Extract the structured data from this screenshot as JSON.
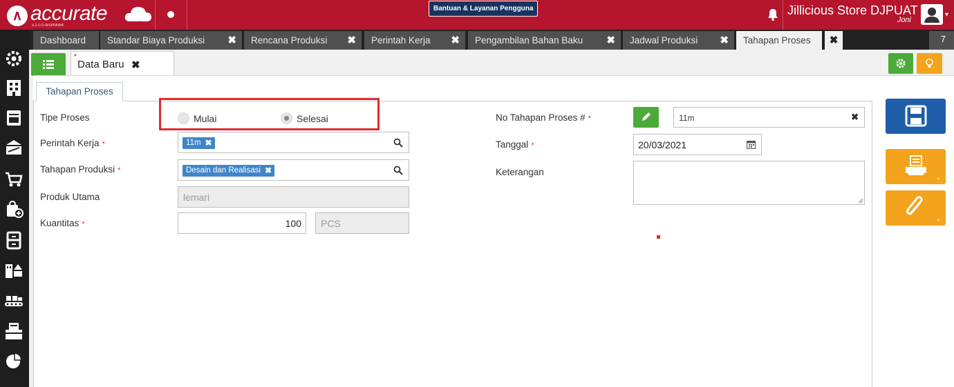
{
  "app": {
    "brand": "accurate",
    "brand_sub": "online",
    "version": "v.1.0.0-test#9564",
    "help_button": "Bantuan & Layanan Pengguna",
    "store_name": "Jillicious Store DJPUAT",
    "user_name": "Joni"
  },
  "tabs": [
    {
      "label": "Dashboard",
      "closable": false
    },
    {
      "label": "Standar Biaya Produksi",
      "closable": true
    },
    {
      "label": "Rencana Produksi",
      "closable": true
    },
    {
      "label": "Perintah Kerja",
      "closable": true
    },
    {
      "label": "Pengambilan Bahan Baku",
      "closable": true
    },
    {
      "label": "Jadwal Produksi",
      "closable": true
    },
    {
      "label": "Tahapan Proses",
      "closable": true,
      "active": true
    }
  ],
  "tab_close_symbol": "✖",
  "tab_count": "7",
  "subtab": {
    "asterisk": "*",
    "label": "Data Baru",
    "close": "✖"
  },
  "section_tab": "Tahapan Proses",
  "form": {
    "tipe_proses": {
      "label": "Tipe Proses",
      "options": [
        "Mulai",
        "Selesai"
      ],
      "selected": "Selesai"
    },
    "perintah_kerja": {
      "label": "Perintah Kerja",
      "required": "*",
      "chip": "11m",
      "chip_close": "✖"
    },
    "tahapan_produksi": {
      "label": "Tahapan Produksi",
      "required": "*",
      "chip": "Desain dan Realisasi",
      "chip_close": "✖"
    },
    "produk_utama": {
      "label": "Produk Utama",
      "value": "lemari"
    },
    "kuantitas": {
      "label": "Kuantitas",
      "required": "*",
      "value": "100",
      "unit": "PCS"
    },
    "no_tahapan": {
      "label": "No Tahapan Proses #",
      "required": "*",
      "value": "11m",
      "clear": "✖"
    },
    "tanggal": {
      "label": "Tanggal",
      "required": "*",
      "value": "20/03/2021"
    },
    "keterangan": {
      "label": "Keterangan",
      "value": ""
    }
  },
  "icons": {
    "sidebar": [
      "gear-icon",
      "building-icon",
      "ledger-icon",
      "bank-icon",
      "cart-icon",
      "bag-add-icon",
      "cabinet-icon",
      "warehouse-icon",
      "conveyor-icon",
      "tax-icon",
      "pie-chart-icon"
    ],
    "actions": [
      "save-icon",
      "print-icon",
      "attachment-icon"
    ]
  },
  "colors": {
    "brand_red": "#b5152d",
    "green": "#4caa3a",
    "orange": "#f4a31c",
    "blue": "#1e5ea8",
    "chip_blue": "#3e86c9",
    "highlight_red": "#e02a2f"
  }
}
